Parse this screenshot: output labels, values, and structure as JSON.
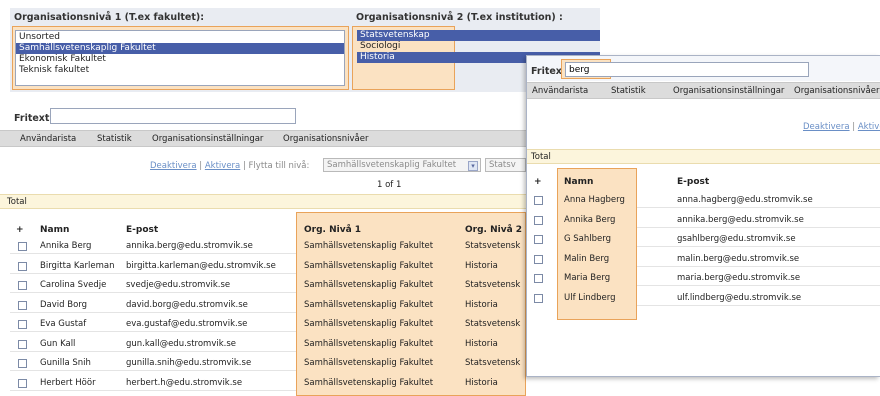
{
  "org1": {
    "label": "Organisationsnivå 1 (T.ex fakultet):",
    "items": [
      "Unsorted",
      "Samhällsvetenskaplig Fakultet",
      "Ekonomisk Fakultet",
      "Teknisk fakultet"
    ]
  },
  "org2": {
    "label": "Organisationsnivå 2 (T.ex institution) :",
    "items": [
      "Statsvetenskap",
      "Sociologi",
      "Historia"
    ]
  },
  "main": {
    "fritext_label": "Fritext",
    "fritext_value": "",
    "tabs": [
      "Användarista",
      "Statistik",
      "Organisationsinställningar",
      "Organisationsnivåer"
    ],
    "deactivate": "Deaktivera",
    "activate": "Aktivera",
    "move_label": "Flytta till nivå:",
    "move_select_1": "Samhällsvetenskaplig Fakultet",
    "move_select_2": "Statsv",
    "pager": "1 of 1",
    "total": "Total",
    "headers": {
      "plus": "+",
      "namn": "Namn",
      "epost": "E-post",
      "org1": "Org. Nivå 1",
      "org2": "Org. Nivå 2"
    },
    "rows": [
      {
        "name": "Annika Berg",
        "email": "annika.berg@edu.stromvik.se",
        "org1": "Samhällsvetenskaplig Fakultet",
        "org2": "Statsvetensk"
      },
      {
        "name": "Birgitta Karleman",
        "email": "birgitta.karleman@edu.stromvik.se",
        "org1": "Samhällsvetenskaplig Fakultet",
        "org2": "Historia"
      },
      {
        "name": "Carolina Svedje",
        "email": "svedje@edu.stromvik.se",
        "org1": "Samhällsvetenskaplig Fakultet",
        "org2": "Statsvetensk"
      },
      {
        "name": "David Borg",
        "email": "david.borg@edu.stromvik.se",
        "org1": "Samhällsvetenskaplig Fakultet",
        "org2": "Historia"
      },
      {
        "name": "Eva Gustaf",
        "email": "eva.gustaf@edu.stromvik.se",
        "org1": "Samhällsvetenskaplig Fakultet",
        "org2": "Statsvetensk"
      },
      {
        "name": "Gun Kall",
        "email": "gun.kall@edu.stromvik.se",
        "org1": "Samhällsvetenskaplig Fakultet",
        "org2": "Historia"
      },
      {
        "name": "Gunilla Snih",
        "email": "gunilla.snih@edu.stromvik.se",
        "org1": "Samhällsvetenskaplig Fakultet",
        "org2": "Statsvetensk"
      },
      {
        "name": "Herbert Höör",
        "email": "herbert.h@edu.stromvik.se",
        "org1": "Samhällsvetenskaplig Fakultet",
        "org2": "Historia"
      }
    ]
  },
  "popup": {
    "fritext_label": "Fritext",
    "fritext_value": "berg",
    "tabs": [
      "Användarista",
      "Statistik",
      "Organisationsinställningar",
      "Organisationsnivåer"
    ],
    "deactivate": "Deaktivera",
    "activate": "Aktivera",
    "total": "Total",
    "headers": {
      "plus": "+",
      "namn": "Namn",
      "epost": "E-post"
    },
    "rows": [
      {
        "name": "Anna Hagberg",
        "email": "anna.hagberg@edu.stromvik.se"
      },
      {
        "name": "Annika Berg",
        "email": "annika.berg@edu.stromvik.se"
      },
      {
        "name": "G Sahlberg",
        "email": "gsahlberg@edu.stromvik.se"
      },
      {
        "name": "Malin Berg",
        "email": "malin.berg@edu.stromvik.se"
      },
      {
        "name": "Maria Berg",
        "email": "maria.berg@edu.stromvik.se"
      },
      {
        "name": "Ulf Lindberg",
        "email": "ulf.lindberg@edu.stromvik.se"
      }
    ]
  },
  "colors": {
    "highlight_fill": "#fbe2c2",
    "highlight_border": "#e9a35a",
    "selection": "#475ea8",
    "total_bar": "#fcf5dc",
    "tab_bar": "#dcdcdc"
  }
}
